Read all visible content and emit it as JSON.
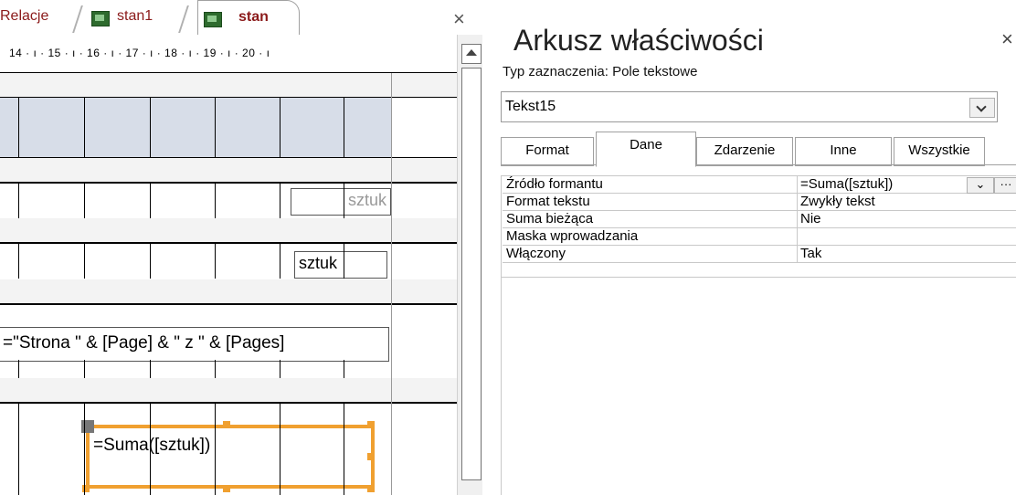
{
  "tabs": {
    "relacje": "Relacje",
    "stan1": "stan1",
    "stan": "stan",
    "close_glyph": "×"
  },
  "ruler": {
    "text": "14 · ı · 15 · ı · 16 · ı · 17 · ı · 18 · ı · 19 · ı · 20 · ı"
  },
  "design": {
    "sztuk_1": "sztuk",
    "sztuk_2": "sztuk",
    "page_expr": "=\"Strona \" & [Page] & \" z \" & [Pages]",
    "suma_expr": "=Suma([sztuk])"
  },
  "props": {
    "title": "Arkusz właściwości",
    "selection_type": "Typ zaznaczenia:  Pole tekstowe",
    "object_name": "Tekst15",
    "tabs": [
      "Format",
      "Dane",
      "Zdarzenie",
      "Inne",
      "Wszystkie"
    ],
    "active_tab": "Dane",
    "rows": [
      {
        "name": "Źródło formantu",
        "value": "=Suma([sztuk])"
      },
      {
        "name": "Format tekstu",
        "value": "Zwykły tekst"
      },
      {
        "name": "Suma bieżąca",
        "value": "Nie"
      },
      {
        "name": "Maska wprowadzania",
        "value": ""
      },
      {
        "name": "Włączony",
        "value": "Tak"
      }
    ],
    "builder_glyph": "···",
    "close_glyph": "×"
  },
  "colors": {
    "selection": "#f0a030",
    "header_band": "#d7dde8",
    "tab_text": "#8b1a1a"
  },
  "icons": [
    "table-icon",
    "close-icon",
    "dropdown-arrow-icon",
    "builder-icon",
    "scroll-up-icon"
  ]
}
